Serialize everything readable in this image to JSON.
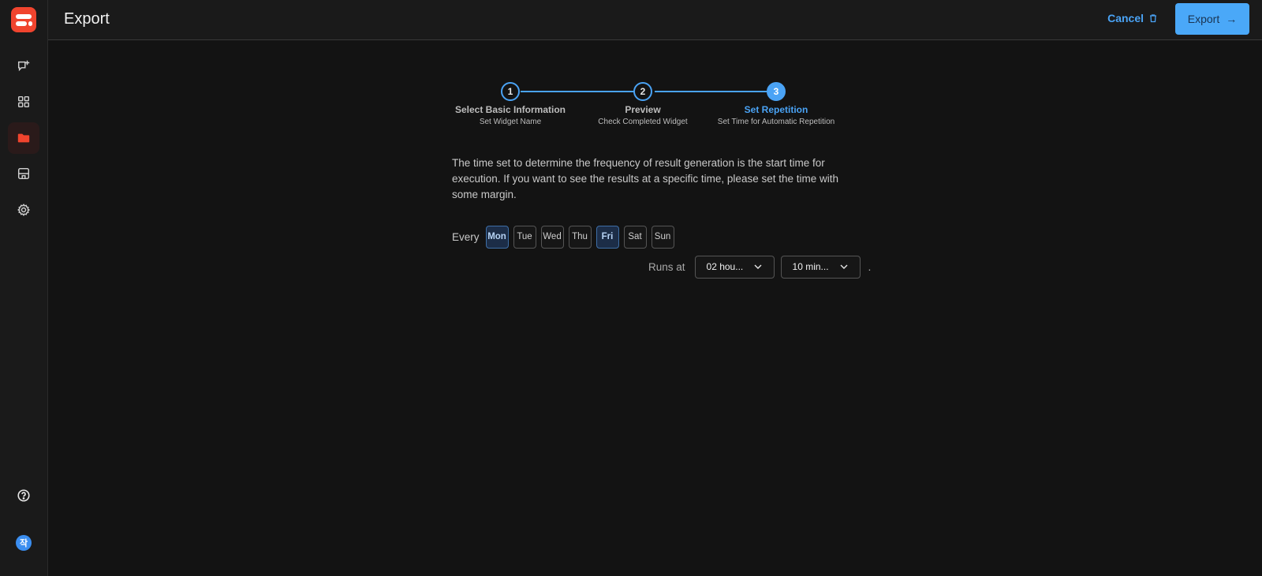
{
  "header": {
    "title": "Export",
    "cancel_label": "Cancel",
    "export_label": "Export"
  },
  "sidebar": {
    "items": [
      {
        "name": "new-chat"
      },
      {
        "name": "widgets"
      },
      {
        "name": "folder",
        "active": true
      },
      {
        "name": "store"
      },
      {
        "name": "settings"
      }
    ],
    "avatar_initial": "작"
  },
  "stepper": {
    "steps": [
      {
        "number": "1",
        "title": "Select Basic Information",
        "subtitle": "Set Widget Name"
      },
      {
        "number": "2",
        "title": "Preview",
        "subtitle": "Check Completed Widget"
      },
      {
        "number": "3",
        "title": "Set Repetition",
        "subtitle": "Set Time for Automatic Repetition"
      }
    ],
    "active_step": 3
  },
  "description": "The time set to determine the frequency of result generation is the start time for execution. If you want to see the results at a specific time, please set the time with some margin.",
  "schedule": {
    "every_label": "Every",
    "days": [
      {
        "label": "Mon",
        "selected": true
      },
      {
        "label": "Tue",
        "selected": false
      },
      {
        "label": "Wed",
        "selected": false
      },
      {
        "label": "Thu",
        "selected": false
      },
      {
        "label": "Fri",
        "selected": true
      },
      {
        "label": "Sat",
        "selected": false
      },
      {
        "label": "Sun",
        "selected": false
      }
    ],
    "runs_at_label": "Runs at",
    "hour_value": "02 hou...",
    "minute_value": "10 min...",
    "trailing": "."
  },
  "colors": {
    "accent": "#4aa3f5",
    "brand": "#f0442e",
    "background": "#131313"
  }
}
